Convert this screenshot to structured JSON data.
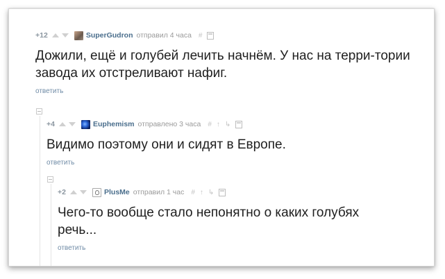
{
  "comments": [
    {
      "score": "+12",
      "avatar_icon": "user-photo-icon",
      "author": "SuperGudron",
      "action": "отправил 4 часа",
      "text": "Дожили, ещё и голубей лечить начнём. У нас на терри-тории завода их отстреливают нафиг.",
      "reply": "ответить"
    },
    {
      "score": "+4",
      "avatar_icon": "earth-icon",
      "author": "Euphemism",
      "action": "отправлено 3 часа",
      "text": "Видимо поэтому они и сидят в Европе.",
      "reply": "ответить"
    },
    {
      "score": "+2",
      "avatar_icon": "user-outline-icon",
      "author": "PlusMe",
      "action": "отправил 1 час",
      "text": "Чего-то вообще стало непонятно о каких голубях речь...",
      "reply": "ответить"
    }
  ],
  "toolbar_icons": [
    "hash-icon",
    "up-arrow-icon",
    "parent-icon",
    "save-icon"
  ],
  "colors": {
    "author": "#4a6e8c",
    "reply": "#6f8ba6",
    "meta": "#9a9a9a"
  }
}
